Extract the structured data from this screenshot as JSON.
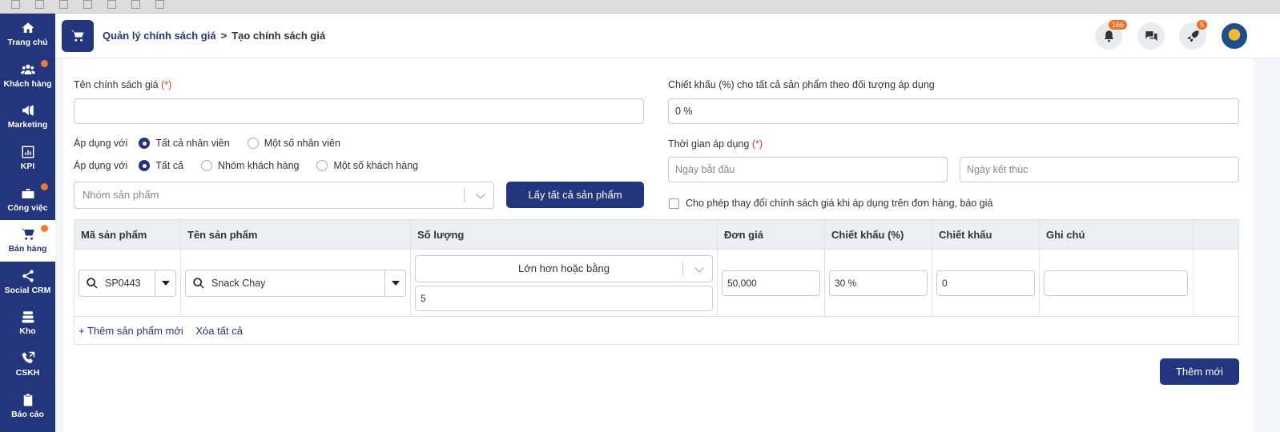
{
  "sidebar": {
    "items": [
      {
        "label": "Trang chủ",
        "icon": "home-icon",
        "dot": false
      },
      {
        "label": "Khách hàng",
        "icon": "users-icon",
        "dot": true
      },
      {
        "label": "Marketing",
        "icon": "megaphone-icon",
        "dot": false
      },
      {
        "label": "KPI",
        "icon": "bar-chart-icon",
        "dot": false
      },
      {
        "label": "Công việc",
        "icon": "briefcase-icon",
        "dot": true
      },
      {
        "label": "Bán hàng",
        "icon": "cart-icon",
        "dot": true,
        "active": true
      },
      {
        "label": "Social CRM",
        "icon": "share-icon",
        "dot": false
      },
      {
        "label": "Kho",
        "icon": "stack-icon",
        "dot": false
      },
      {
        "label": "CSKH",
        "icon": "phone-icon",
        "dot": false
      },
      {
        "label": "Báo cáo",
        "icon": "clipboard-icon",
        "dot": false
      }
    ]
  },
  "header": {
    "breadcrumb_parent": "Quản lý chính sách giá",
    "breadcrumb_separator": ">",
    "breadcrumb_current": "Tạo chính sách giá",
    "notification_count": "166",
    "rocket_count": "5"
  },
  "form": {
    "name_label": "Tên chính sách giá",
    "required_mark": "(*)",
    "name_value": "",
    "discount_label": "Chiết khấu (%) cho tất cả sản phẩm theo đối tượng áp dụng",
    "discount_value": "0 %",
    "apply_label_1": "Áp dụng với",
    "apply_staff_options": [
      "Tất cả nhân viên",
      "Một số nhân viên"
    ],
    "apply_label_2": "Áp dụng với",
    "apply_customer_options": [
      "Tất cả",
      "Nhóm khách hàng",
      "Một số khách hàng"
    ],
    "time_label": "Thời gian áp dụng",
    "start_placeholder": "Ngày bắt đầu",
    "end_placeholder": "Ngày kết thúc",
    "product_group_placeholder": "Nhóm sản phẩm",
    "get_all_button": "Lấy tất cả sản phẩm",
    "allow_change_label": "Cho phép thay đổi chính sách giá khi áp dụng trên đơn hàng, báo giá"
  },
  "table": {
    "headers": [
      "Mã sản phẩm",
      "Tên sản phẩm",
      "Số lượng",
      "Đơn giá",
      "Chiết khấu (%)",
      "Chiết khấu",
      "Ghi chú"
    ],
    "row": {
      "code": "SP0443",
      "name": "Snack Chay",
      "quantity_condition": "Lớn hơn hoặc bằng",
      "quantity": "5",
      "unit_price": "50,000",
      "discount_percent": "30 %",
      "discount": "0",
      "note": ""
    },
    "add_product_link": "+ Thêm sản phẩm mới",
    "clear_all_link": "Xóa tất cả"
  },
  "submit_button": "Thêm mới",
  "colors": {
    "primary": "#23357d",
    "badge": "#f26f21",
    "required": "#e0352b"
  }
}
